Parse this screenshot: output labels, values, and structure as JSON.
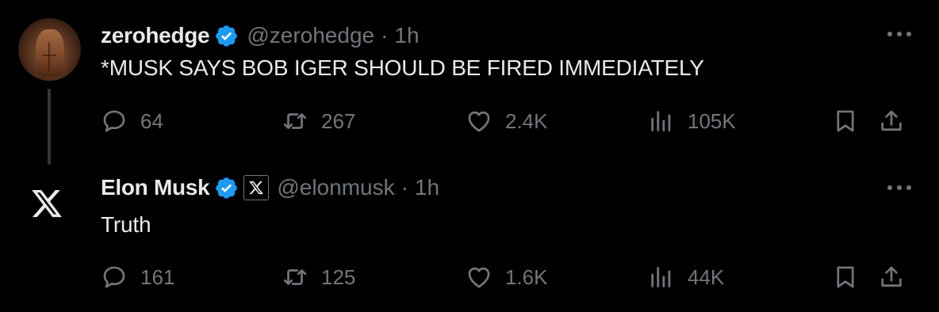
{
  "colors": {
    "background": "#000000",
    "primary_text": "#e7e9ea",
    "secondary_text": "#71767b",
    "verified_badge": "#1d9bf0",
    "thread_line": "#333639"
  },
  "tweets": [
    {
      "author_name": "zerohedge",
      "handle": "@zerohedge",
      "separator": "·",
      "time": "1h",
      "text": "*MUSK SAYS BOB IGER SHOULD BE FIRED IMMEDIATELY",
      "verified": true,
      "avatar": "profile-photo",
      "stats": {
        "replies": "64",
        "retweets": "267",
        "likes": "2.4K",
        "views": "105K"
      }
    },
    {
      "author_name": "Elon Musk",
      "handle": "@elonmusk",
      "separator": "·",
      "time": "1h",
      "text": "Truth",
      "verified": true,
      "affiliate_badge": "x-logo",
      "avatar": "x-logo",
      "stats": {
        "replies": "161",
        "retweets": "125",
        "likes": "1.6K",
        "views": "44K"
      }
    }
  ],
  "icons": {
    "reply": "speech-bubble-icon",
    "retweet": "retweet-arrows-icon",
    "like": "heart-icon",
    "views": "bar-chart-icon",
    "bookmark": "bookmark-icon",
    "share": "share-upload-icon",
    "more": "three-dots-icon"
  }
}
